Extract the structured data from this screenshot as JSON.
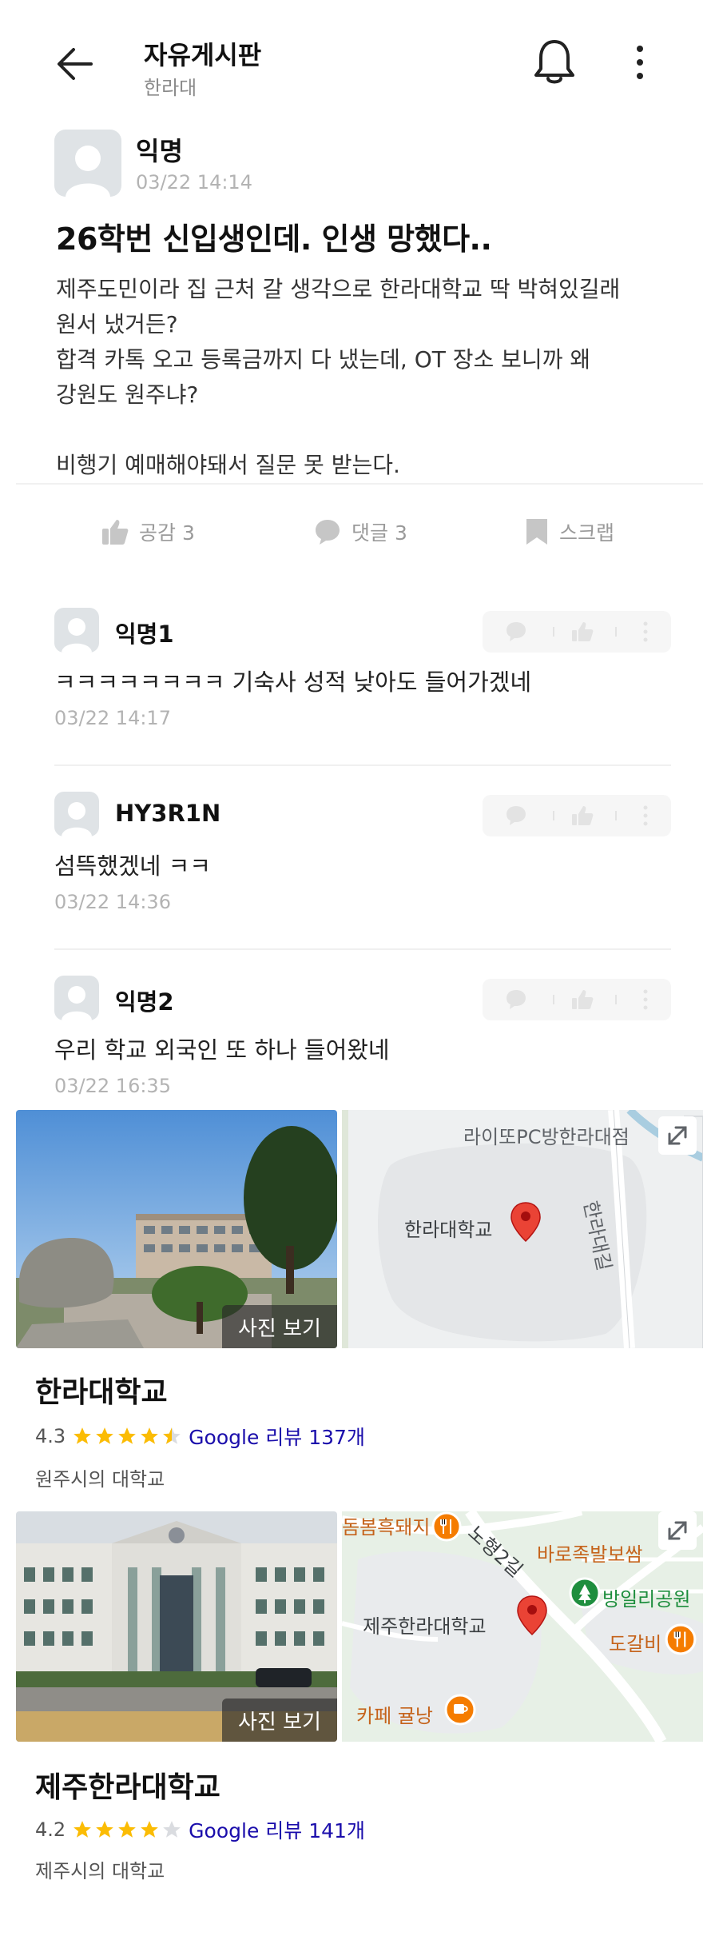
{
  "header": {
    "title": "자유게시판",
    "subtitle": "한라대"
  },
  "post": {
    "author": "익명",
    "time": "03/22 14:14",
    "title": "26학번 신입생인데. 인생 망했다..",
    "body_lines": [
      "제주도민이라 집 근처 갈 생각으로 한라대학교 딱 박혀있길래",
      "원서 냈거든?",
      "합격 카톡 오고 등록금까지 다 냈는데, OT 장소 보니까 왜",
      "강원도 원주냐?",
      "",
      "비행기 예매해야돼서 질문 못 받는다."
    ]
  },
  "actions": {
    "like": "공감 3",
    "comment": "댓글 3",
    "scrap": "스크랩"
  },
  "comments": [
    {
      "author": "익명1",
      "text": "ㅋㅋㅋㅋㅋㅋㅋㅋ 기숙사 성적 낮아도 들어가겠네",
      "time": "03/22 14:17"
    },
    {
      "author": "HY3R1N",
      "text": "섬뜩했겠네 ㅋㅋ",
      "time": "03/22 14:36"
    },
    {
      "author": "익명2",
      "text": "우리 학교 외국인 또 하나 들어왔네",
      "time": "03/22 16:35"
    }
  ],
  "places": [
    {
      "name": "한라대학교",
      "rating": "4.3",
      "rating_value": 4.3,
      "review": "Google 리뷰 137개",
      "type": "원주시의 대학교",
      "photo_label": "사진 보기",
      "map_labels": {
        "poi": "라이또PC방한라대점",
        "pin": "한라대학교",
        "road": "한라대길"
      }
    },
    {
      "name": "제주한라대학교",
      "rating": "4.2",
      "rating_value": 4.2,
      "review": "Google 리뷰 141개",
      "type": "제주시의 대학교",
      "photo_label": "사진 보기",
      "map_labels": {
        "poi1": "돔봄흑돼지",
        "road": "노형2길",
        "poi2": "바로족발보쌈",
        "park": "방일리공원",
        "pin": "제주한라대학교",
        "poi3": "도갈비",
        "cafe": "카페 귤낭"
      }
    }
  ],
  "colors": {
    "pin": "#ea4335",
    "star": "#fbbc04",
    "restaurant": "#f57c00",
    "park": "#1e8e3e",
    "link": "#1a0dab"
  }
}
